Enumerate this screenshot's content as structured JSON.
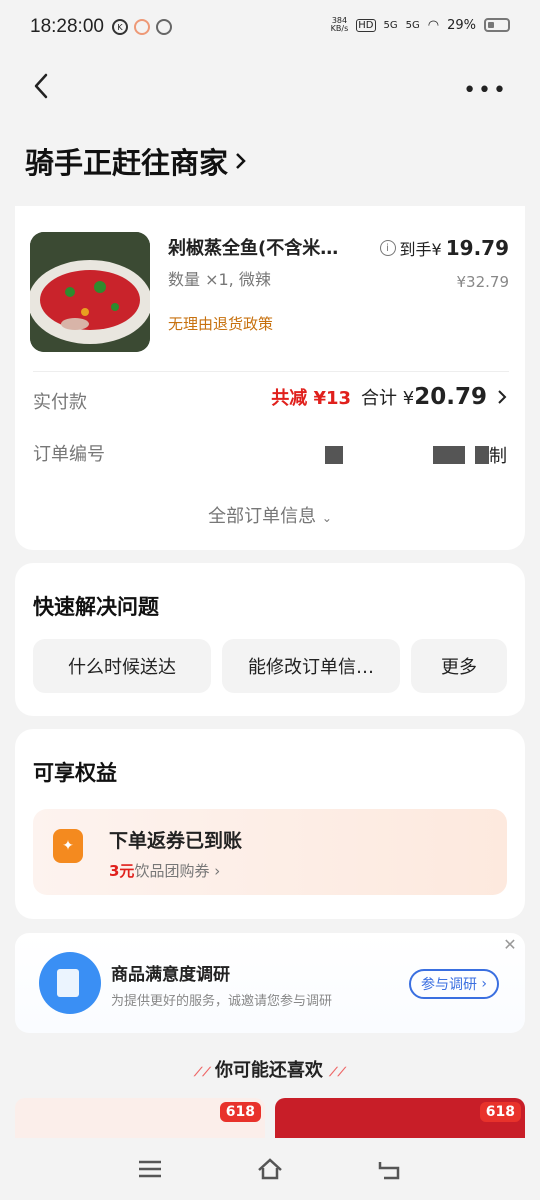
{
  "status_bar": {
    "time": "18:28:00",
    "net_speed": "384",
    "net_unit": "KB/s",
    "sig1": "5G",
    "sig2": "5G",
    "battery": "29%"
  },
  "header": {
    "title": "骑手正赶往商家",
    "more_label": "•••"
  },
  "order": {
    "product_name": "剁椒蒸全鱼(不含米…",
    "qty_spec": "数量 ×1, 微辣",
    "policy": "无理由退货政策",
    "price_label": "到手¥",
    "price": "19.79",
    "original_price": "¥32.79",
    "paid_label": "实付款",
    "discount": "共减 ¥13",
    "total_label": "合计 ¥",
    "total": "20.79",
    "order_no_label": "订单编号",
    "order_no_tail": "制",
    "all_info": "全部订单信息"
  },
  "quick": {
    "title": "快速解决问题",
    "chips": [
      "什么时候送达",
      "能修改订单信…",
      "更多"
    ]
  },
  "benefit": {
    "title": "可享权益",
    "coupon_title": "下单返券已到账",
    "coupon_amount": "3元",
    "coupon_desc": "饮品团购券"
  },
  "survey": {
    "title": "商品满意度调研",
    "subtitle": "为提供更好的服务，诚邀请您参与调研",
    "button": "参与调研"
  },
  "recommend": {
    "title": "你可能还喜欢",
    "badge1": "618",
    "badge2": "618"
  }
}
